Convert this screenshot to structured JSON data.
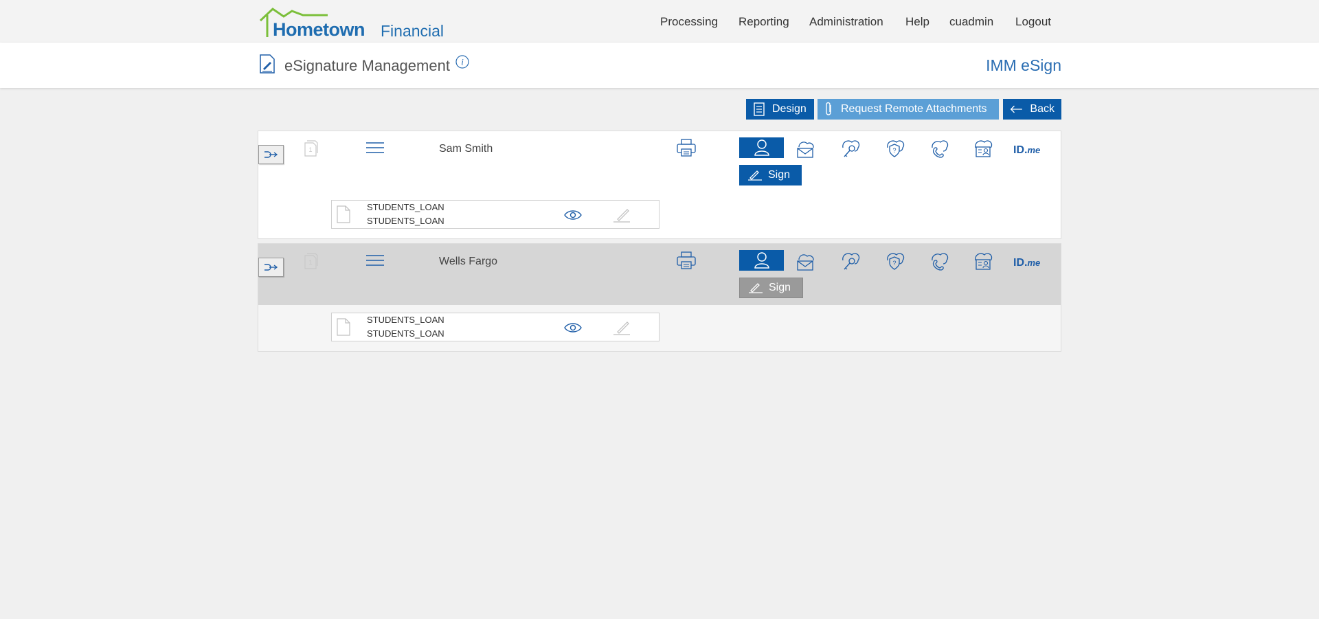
{
  "header": {
    "logo_main": "Hometown",
    "logo_sub": "Financial",
    "nav": [
      "Processing",
      "Reporting",
      "Administration",
      "Help",
      "cuadmin",
      "Logout"
    ]
  },
  "subheader": {
    "title": "eSignature Management",
    "app_name": "IMM eSign"
  },
  "toolbar": {
    "design_label": "Design",
    "attachments_label": "Request Remote Attachments",
    "back_label": "Back"
  },
  "signers": [
    {
      "name": "Sam Smith",
      "sign_label": "Sign",
      "sign_enabled": true,
      "idme_label": "ID.",
      "idme_suffix": "me",
      "documents": [
        {
          "line1": "STUDENTS_LOAN",
          "line2": "STUDENTS_LOAN"
        }
      ]
    },
    {
      "name": "Wells Fargo",
      "sign_label": "Sign",
      "sign_enabled": false,
      "idme_label": "ID.",
      "idme_suffix": "me",
      "documents": [
        {
          "line1": "STUDENTS_LOAN",
          "line2": "STUDENTS_LOAN"
        }
      ]
    }
  ],
  "colors": {
    "primary": "#0a5ba8",
    "primary_light": "#5b9fd6",
    "disabled": "#9a9a9a",
    "logo_green": "#7bbf3a",
    "logo_blue": "#1f6db0"
  }
}
